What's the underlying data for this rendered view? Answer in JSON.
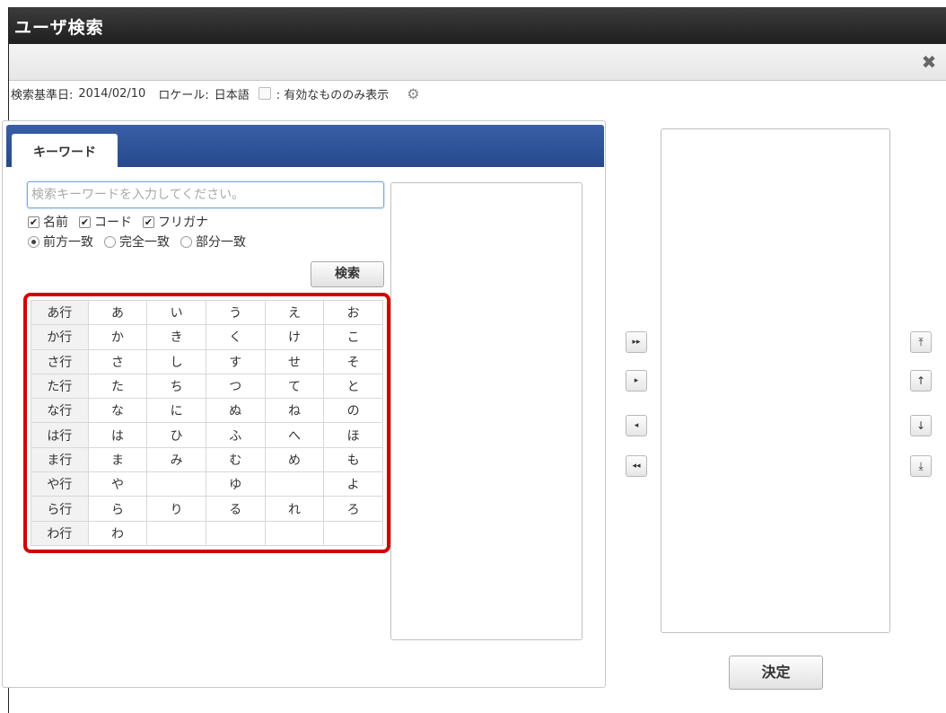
{
  "window": {
    "title": "ユーザ検索",
    "close_icon": "✖"
  },
  "infobar": {
    "date_label": "検索基準日:",
    "date_value": "2014/02/10",
    "locale_label": "ロケール:",
    "locale_value": "日本語",
    "valid_only_label": ": 有効なもののみ表示",
    "gear_icon": "⚙"
  },
  "search": {
    "tab_label": "キーワード",
    "keyword_placeholder": "検索キーワードを入力してください。",
    "fields": [
      {
        "label": "名前",
        "checked": true
      },
      {
        "label": "コード",
        "checked": true
      },
      {
        "label": "フリガナ",
        "checked": true
      }
    ],
    "match_modes": [
      {
        "label": "前方一致",
        "selected": true
      },
      {
        "label": "完全一致",
        "selected": false
      },
      {
        "label": "部分一致",
        "selected": false
      }
    ],
    "search_button": "検索"
  },
  "kana_table": {
    "rows": [
      [
        "あ行",
        "あ",
        "い",
        "う",
        "え",
        "お"
      ],
      [
        "か行",
        "か",
        "き",
        "く",
        "け",
        "こ"
      ],
      [
        "さ行",
        "さ",
        "し",
        "す",
        "せ",
        "そ"
      ],
      [
        "た行",
        "た",
        "ち",
        "つ",
        "て",
        "と"
      ],
      [
        "な行",
        "な",
        "に",
        "ぬ",
        "ね",
        "の"
      ],
      [
        "は行",
        "は",
        "ひ",
        "ふ",
        "へ",
        "ほ"
      ],
      [
        "ま行",
        "ま",
        "み",
        "む",
        "め",
        "も"
      ],
      [
        "や行",
        "や",
        "",
        "ゆ",
        "",
        "よ"
      ],
      [
        "ら行",
        "ら",
        "り",
        "る",
        "れ",
        "ろ"
      ],
      [
        "わ行",
        "わ",
        "",
        "",
        "",
        ""
      ]
    ]
  },
  "move_buttons": {
    "add_all": "▸▸",
    "add": "▸",
    "remove": "◂",
    "remove_all": "◂◂"
  },
  "order_buttons": {
    "top": "⤒",
    "up": "↑",
    "down": "↓",
    "bottom": "⤓"
  },
  "decide_button": "決定"
}
